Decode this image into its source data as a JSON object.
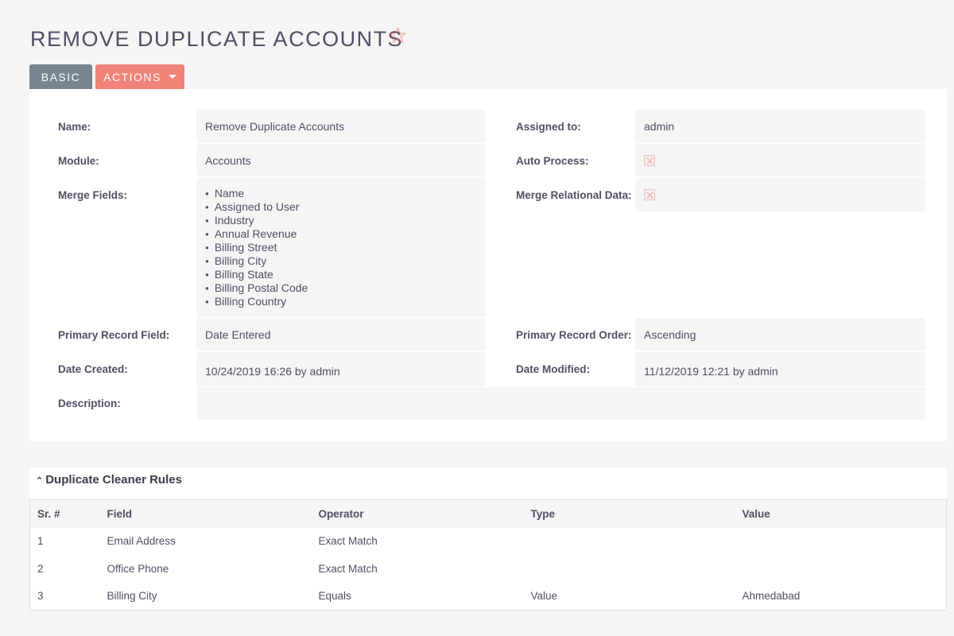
{
  "header": {
    "title": "REMOVE DUPLICATE ACCOUNTS",
    "favorite_icon": "star-outline-icon"
  },
  "tabs": {
    "basic": "BASIC",
    "actions": "ACTIONS"
  },
  "detail": {
    "name_label": "Name:",
    "name": "Remove Duplicate Accounts",
    "assigned_label": "Assigned to:",
    "assigned": "admin",
    "module_label": "Module:",
    "module": "Accounts",
    "auto_label": "Auto Process:",
    "auto_process": false,
    "merge_label": "Merge Fields:",
    "merge_fields": [
      "Name",
      "Assigned to User",
      "Industry",
      "Annual Revenue",
      "Billing Street",
      "Billing City",
      "Billing State",
      "Billing Postal Code",
      "Billing Country"
    ],
    "merge_rel_label": "Merge Relational Data:",
    "merge_relational": false,
    "primary_field_label": "Primary Record Field:",
    "primary_field": "Date Entered",
    "primary_order_label": "Primary Record Order:",
    "primary_order": "Ascending",
    "created_label": "Date Created:",
    "created": "10/24/2019 16:26 by admin",
    "modified_label": "Date Modified:",
    "modified": "11/12/2019 12:21 by admin",
    "description_label": "Description:",
    "description": ""
  },
  "rules": {
    "title": "Duplicate Cleaner Rules",
    "columns": [
      "Sr. #",
      "Field",
      "Operator",
      "Type",
      "Value"
    ],
    "rows": [
      [
        "1",
        "Email Address",
        "Exact Match",
        "",
        ""
      ],
      [
        "2",
        "Office Phone",
        "Exact Match",
        "",
        ""
      ],
      [
        "3",
        "Billing City",
        "Equals",
        "Value",
        "Ahmedabad"
      ]
    ]
  }
}
